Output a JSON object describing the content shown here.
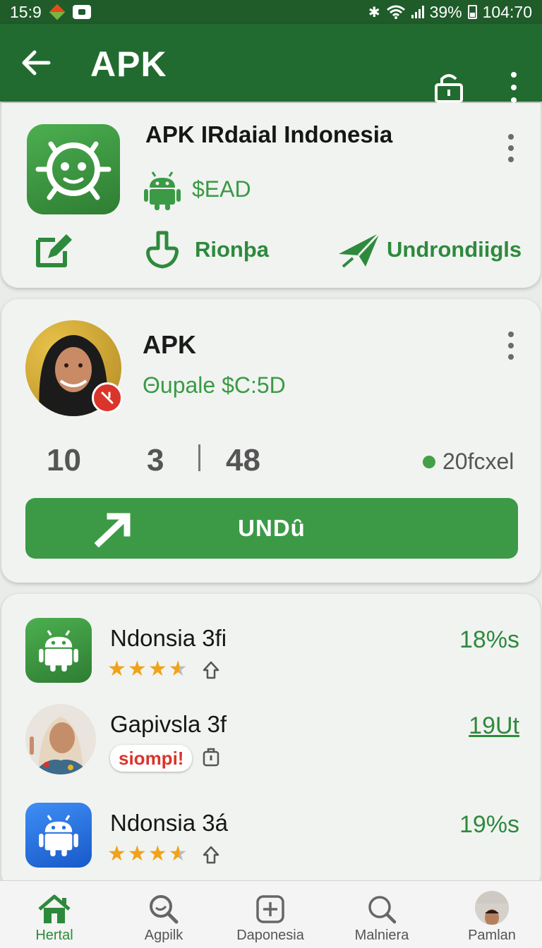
{
  "status_bar": {
    "time": "15:9",
    "battery": "39%",
    "clock": "104:70"
  },
  "app_bar": {
    "title": "APK"
  },
  "featured_app": {
    "title": "APK IRdaial Indonesia",
    "price": "$EAD",
    "action_1": "Rionþa",
    "action_2": "Undrondiigls",
    "accent_color": "#3a9a45"
  },
  "profile_card": {
    "title": "APK",
    "subtitle": "Θupale $C:5D",
    "stats": [
      "10",
      "3",
      "48"
    ],
    "online_label": "20fcxel",
    "cta_label": "UNDȗ",
    "cta_color": "#3c9a47"
  },
  "app_list": [
    {
      "name": "Ndonsia 3fi",
      "value": "18%s",
      "icon": "android-icon",
      "rating": 3.5
    },
    {
      "name": "Gapivsla 3f",
      "value": "19Ut",
      "tag": "siompi!",
      "icon": "avatar"
    },
    {
      "name": "Ndonsia 3á",
      "value": "19%s",
      "icon": "android-icon",
      "rating": 3.5
    }
  ],
  "bottom_nav": [
    {
      "label": "Hertal",
      "icon": "home-icon",
      "active": true
    },
    {
      "label": "Agpilk",
      "icon": "search-icon"
    },
    {
      "label": "Daponesia",
      "icon": "add-box-icon"
    },
    {
      "label": "Malniera",
      "icon": "search-heart-icon"
    },
    {
      "label": "Pamlan",
      "icon": "profile-avatar"
    }
  ]
}
